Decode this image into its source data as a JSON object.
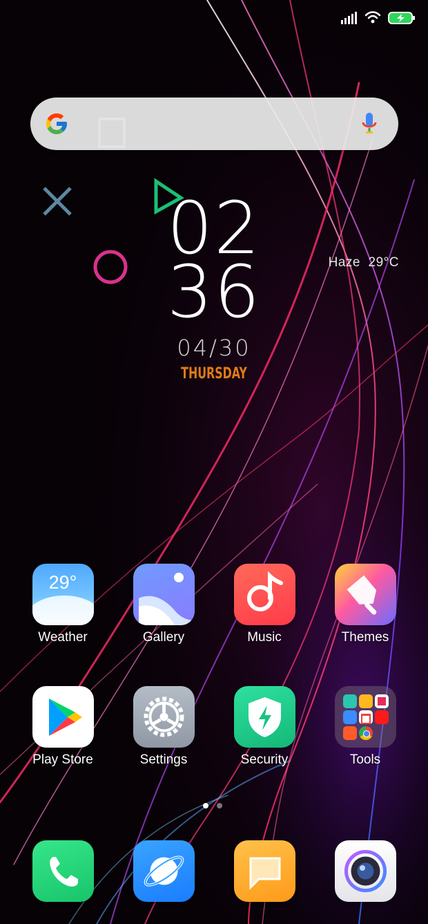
{
  "clock": {
    "hour": "02",
    "minute": "36",
    "date": "04/30",
    "day": "THURSDAY"
  },
  "weather": {
    "summary": "Haze  29°C"
  },
  "apps": [
    {
      "label": "Weather",
      "icon": "weather-icon",
      "badge": "29°"
    },
    {
      "label": "Gallery",
      "icon": "gallery-icon"
    },
    {
      "label": "Music",
      "icon": "music-icon"
    },
    {
      "label": "Themes",
      "icon": "themes-icon"
    },
    {
      "label": "Play Store",
      "icon": "play-store-icon"
    },
    {
      "label": "Settings",
      "icon": "settings-icon"
    },
    {
      "label": "Security",
      "icon": "security-icon"
    },
    {
      "label": "Tools",
      "icon": "tools-folder-icon"
    }
  ],
  "dock": [
    {
      "icon": "phone-icon"
    },
    {
      "icon": "browser-icon"
    },
    {
      "icon": "messages-icon"
    },
    {
      "icon": "camera-icon"
    }
  ],
  "pager": {
    "pages": 2,
    "current": 1
  },
  "colors": {
    "day_accent": "#e07a18",
    "background": "#0a0308"
  }
}
